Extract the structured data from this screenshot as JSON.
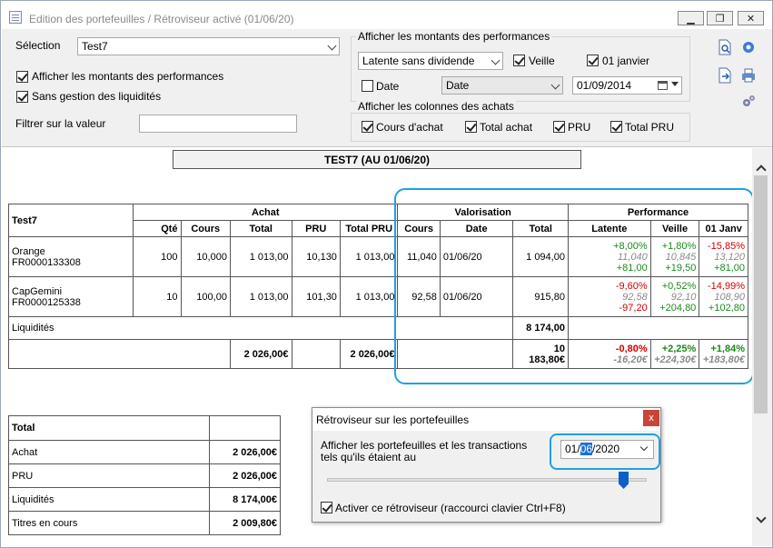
{
  "window": {
    "title": "Edition des portefeuilles / Rétroviseur activé (01/06/20)"
  },
  "top": {
    "selection_label": "Sélection",
    "selection_value": "Test7",
    "show_perf_amounts": "Afficher les montants des performances",
    "no_liquidity": "Sans gestion des liquidités",
    "filter_label": "Filtrer sur la valeur",
    "filter_value": "",
    "perf_group_title": "Afficher les montants des performances",
    "perf_mode": "Latente sans dividende",
    "veille": "Veille",
    "janvier": "01 janvier",
    "date_label": "Date",
    "date_select": "Date",
    "date_value": "01/09/2014",
    "cols_group_title": "Afficher les colonnes des achats",
    "col_cours_achat": "Cours d'achat",
    "col_total_achat": "Total achat",
    "col_pru": "PRU",
    "col_total_pru": "Total PRU"
  },
  "report": {
    "title": "TEST7 (AU 01/06/20)",
    "portfolio": "Test7",
    "group_achat": "Achat",
    "group_valorisation": "Valorisation",
    "group_performance": "Performance",
    "cols": {
      "qte": "Qté",
      "cours": "Cours",
      "total": "Total",
      "pru": "PRU",
      "total_pru": "Total PRU",
      "v_cours": "Cours",
      "v_date": "Date",
      "v_total": "Total",
      "latente": "Latente",
      "veille": "Veille",
      "janv": "01 Janv"
    },
    "rows": [
      {
        "name": "Orange",
        "isin": "FR0000133308",
        "qte": "100",
        "cours": "10,000",
        "total": "1 013,00",
        "pru": "10,130",
        "total_pru": "1 013,00",
        "v_cours": "11,040",
        "v_date": "01/06/20",
        "v_total": "1 094,00",
        "lat_pct": "+8,00%",
        "lat_ref": "11,040",
        "lat_amt": "+81,00",
        "vei_pct": "+1,80%",
        "vei_ref": "10,845",
        "vei_amt": "+19,50",
        "jan_pct": "-15,85%",
        "jan_ref": "13,120",
        "jan_amt": "+81,00"
      },
      {
        "name": "CapGemini",
        "isin": "FR0000125338",
        "qte": "10",
        "cours": "100,00",
        "total": "1 013,00",
        "pru": "101,30",
        "total_pru": "1 013,00",
        "v_cours": "92,58",
        "v_date": "01/06/20",
        "v_total": "915,80",
        "lat_pct": "-9,60%",
        "lat_ref": "92,58",
        "lat_amt": "-97,20",
        "vei_pct": "+0,52%",
        "vei_ref": "92,10",
        "vei_amt": "+204,80",
        "jan_pct": "-14,99%",
        "jan_ref": "108,90",
        "jan_amt": "+102,80"
      }
    ],
    "liquidites_label": "Liquidités",
    "liquidites_value": "8 174,00",
    "totals": {
      "total": "2 026,00€",
      "total_pru": "2 026,00€",
      "v_total": "10 183,80€",
      "lat_pct": "-0,80%",
      "lat_amt": "-16,20€",
      "vei_pct": "+2,25%",
      "vei_amt": "+224,30€",
      "jan_pct": "+1,84%",
      "jan_amt": "+183,80€"
    },
    "summary": [
      {
        "label": "Total",
        "value": ""
      },
      {
        "label": "Achat",
        "value": "2 026,00€"
      },
      {
        "label": "PRU",
        "value": "2 026,00€"
      },
      {
        "label": "Liquidités",
        "value": "8 174,00€"
      },
      {
        "label": "Titres en cours",
        "value": "2 009,80€"
      }
    ]
  },
  "dialog": {
    "title": "Rétroviseur sur les portefeuilles",
    "close": "x",
    "text1": "Afficher les portefeuilles et les transactions",
    "text2": "tels qu'ils étaient au",
    "date_pre": "01/",
    "date_sel": "06",
    "date_post": "/2020",
    "activate": "Activer ce rétroviseur (raccourci clavier Ctrl+F8)",
    "slider_level": 0.94
  }
}
